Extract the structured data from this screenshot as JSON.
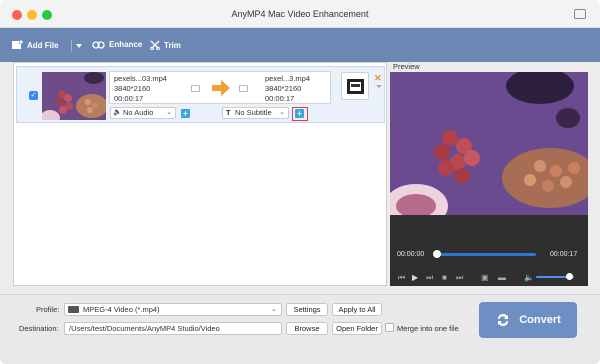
{
  "window": {
    "title": "AnyMP4 Mac Video Enhancement"
  },
  "toolbar": {
    "add_file_label": "Add File",
    "enhance_label": "Enhance",
    "trim_label": "Trim"
  },
  "file_item": {
    "source": {
      "name": "pexels...03.mp4",
      "resolution": "3840*2160",
      "duration": "00:00:17"
    },
    "output": {
      "name": "pexel...3.mp4",
      "resolution": "3840*2160",
      "duration": "00:00:17"
    },
    "audio": "No Audio",
    "subtitle": "No Subtitle",
    "remove_glyph": "✕"
  },
  "preview": {
    "label": "Preview",
    "time_current": "00:00:00",
    "time_total": "00:00:17",
    "progress": 0.0,
    "volume": 0.9
  },
  "bottom": {
    "profile_label": "Profile:",
    "profile_value": "MPEG-4 Video (*.mp4)",
    "settings_label": "Settings",
    "apply_all_label": "Apply to All",
    "destination_label": "Destination:",
    "destination_value": "/Users/test/Documents/AnyMP4 Studio/Video",
    "browse_label": "Browse",
    "open_folder_label": "Open Folder",
    "merge_label": "Merge into one file",
    "convert_label": "Convert"
  },
  "colors": {
    "accent": "#6b87b3",
    "convert": "#6e8fc3",
    "highlight": "#e53b3b",
    "arrow": "#f0a030"
  }
}
